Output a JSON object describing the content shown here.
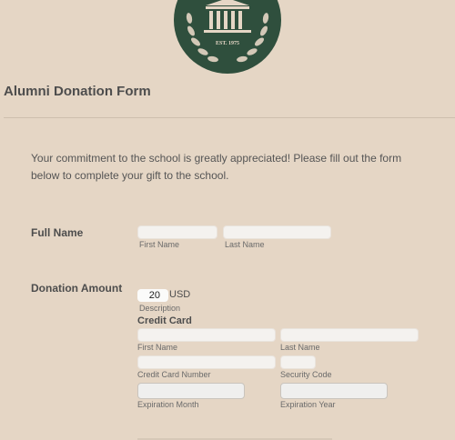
{
  "logo": {
    "est_text": "EST. 1975",
    "color": "#2f4f3d"
  },
  "form": {
    "title": "Alumni Donation Form",
    "intro": "Your commitment to the school is greatly appreciated! Please fill out the form below to complete your gift to the school."
  },
  "full_name": {
    "label": "Full Name",
    "first_sub": "First Name",
    "last_sub": "Last Name"
  },
  "donation": {
    "label": "Donation Amount",
    "amount": "20",
    "currency": "USD",
    "description_sub": "Description"
  },
  "credit_card": {
    "title": "Credit Card",
    "first_sub": "First Name",
    "last_sub": "Last Name",
    "number_sub": "Credit Card Number",
    "security_sub": "Security Code",
    "exp_month_sub": "Expiration Month",
    "exp_year_sub": "Expiration Year"
  },
  "colors": {
    "background": "#e5d6c5",
    "accent": "#2f4f3d"
  }
}
